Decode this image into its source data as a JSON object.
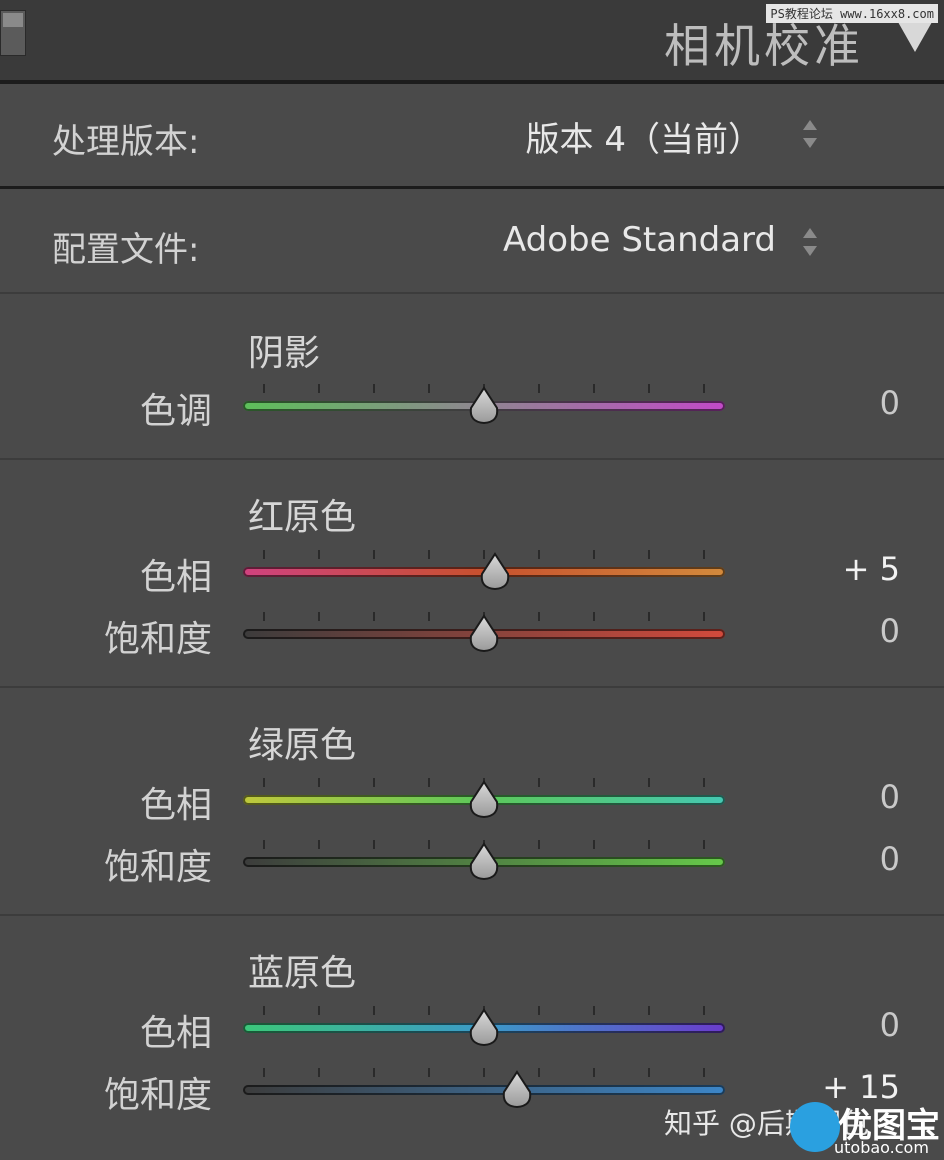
{
  "header": {
    "title": "相机校准",
    "watermark": "PS教程论坛 www.16xx8.com"
  },
  "process": {
    "label": "处理版本:",
    "value": "版本 4（当前）"
  },
  "profile": {
    "label": "配置文件:",
    "value": "Adobe Standard"
  },
  "sections": [
    {
      "title": "阴影",
      "sliders": [
        {
          "label": "色调",
          "value": "0",
          "level": 0,
          "range": [
            -100,
            100
          ],
          "gradient": [
            "#5dc05a",
            "#c24ac8"
          ]
        }
      ]
    },
    {
      "title": "红原色",
      "sliders": [
        {
          "label": "色相",
          "value": "+ 5",
          "level": 5,
          "range": [
            -100,
            100
          ],
          "gradient": [
            "#d0427f",
            "#c8512e",
            "#d38a3c"
          ]
        },
        {
          "label": "饱和度",
          "value": "0",
          "level": 0,
          "range": [
            -100,
            100
          ],
          "gradient": [
            "#3c3c3c",
            "#d24a3c"
          ]
        }
      ]
    },
    {
      "title": "绿原色",
      "sliders": [
        {
          "label": "色相",
          "value": "0",
          "level": 0,
          "range": [
            -100,
            100
          ],
          "gradient": [
            "#bfc83c",
            "#5cc85a",
            "#45c8b2"
          ]
        },
        {
          "label": "饱和度",
          "value": "0",
          "level": 0,
          "range": [
            -100,
            100
          ],
          "gradient": [
            "#3c3c3c",
            "#66c94a"
          ]
        }
      ]
    },
    {
      "title": "蓝原色",
      "sliders": [
        {
          "label": "色相",
          "value": "0",
          "level": 0,
          "range": [
            -100,
            100
          ],
          "gradient": [
            "#3cc87a",
            "#3c9ac8",
            "#6a3ccc"
          ]
        },
        {
          "label": "饱和度",
          "value": "+ 15",
          "level": 15,
          "range": [
            -100,
            100
          ],
          "gradient": [
            "#3c3c3c",
            "#3c86c8"
          ]
        }
      ]
    }
  ],
  "watermarks": {
    "zhihu": "知乎 @后期调色",
    "logo": "优图宝",
    "url": "utobao.com"
  }
}
